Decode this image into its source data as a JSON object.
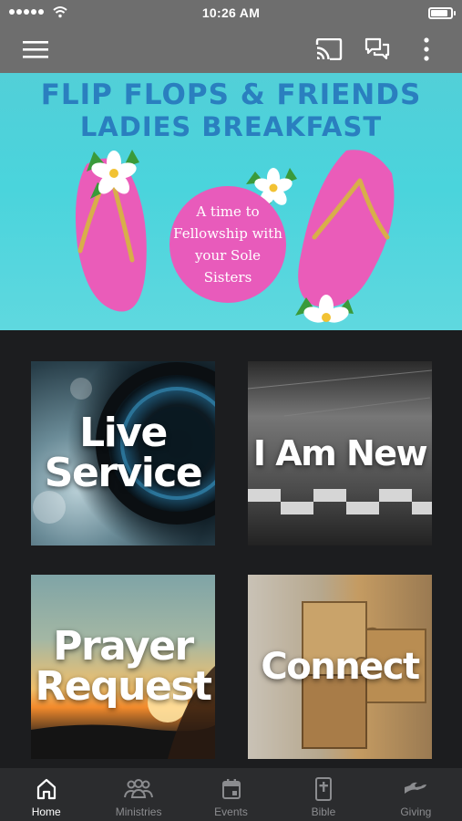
{
  "status_bar": {
    "time": "10:26 AM"
  },
  "banner": {
    "title_line1": "FLIP FLOPS & FRIENDS",
    "title_line2": "LADIES BREAKFAST",
    "tagline": "A time to Fellowship with your Sole Sisters",
    "page_count": 4,
    "active_page": 1
  },
  "tiles": [
    {
      "id": "live-service",
      "label_line1": "Live",
      "label_line2": "Service"
    },
    {
      "id": "i-am-new",
      "label_line1": "I Am New",
      "label_line2": ""
    },
    {
      "id": "prayer-request",
      "label_line1": "Prayer",
      "label_line2": "Request"
    },
    {
      "id": "connect",
      "label_line1": "Connect",
      "label_line2": ""
    }
  ],
  "bottom_nav": {
    "items": [
      {
        "label": "Home",
        "icon": "home-icon",
        "active": true
      },
      {
        "label": "Ministries",
        "icon": "people-icon",
        "active": false
      },
      {
        "label": "Events",
        "icon": "calendar-icon",
        "active": false
      },
      {
        "label": "Bible",
        "icon": "bible-icon",
        "active": false
      },
      {
        "label": "Giving",
        "icon": "giving-hand-icon",
        "active": false
      }
    ]
  },
  "colors": {
    "app_bar": "#6e6e6e",
    "background": "#1c1d1f",
    "nav_background": "#2b2c2e",
    "banner_title": "#2a7fbf",
    "banner_bg": "#4ad4dc",
    "tagline_circle": "#e85bbb"
  }
}
